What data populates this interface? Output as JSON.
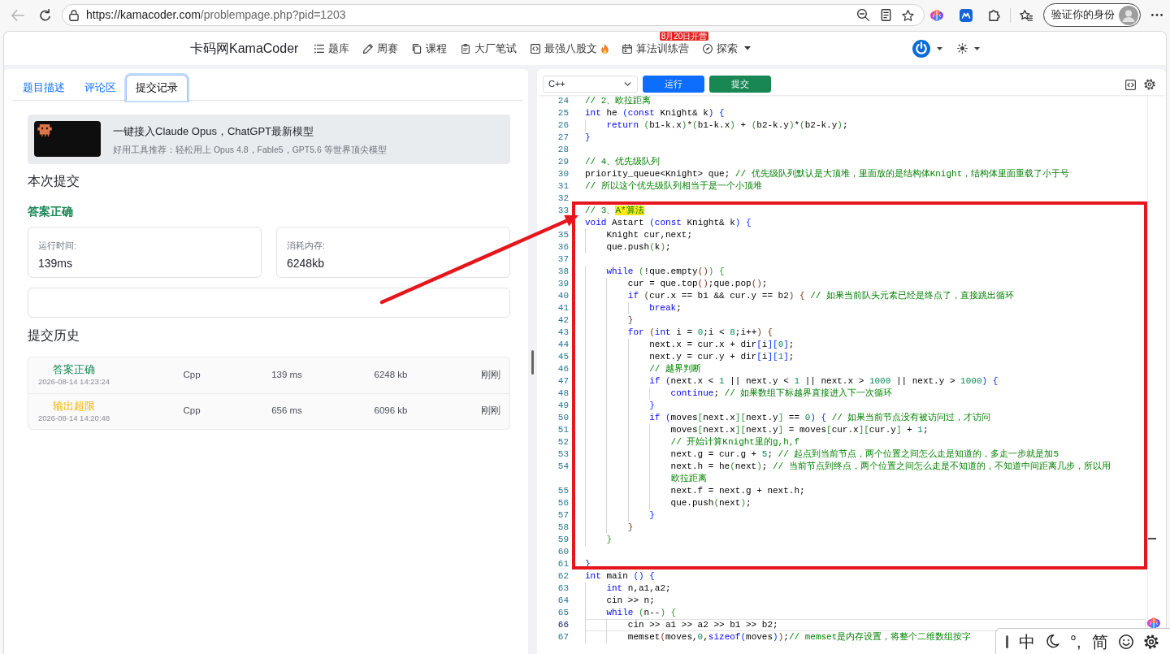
{
  "browser": {
    "back_disabled": true,
    "url_host": "https://kamacoder.com",
    "url_path": "/problempage.php?pid=1203",
    "profile_button": "验证你的身份"
  },
  "site_nav": {
    "brand": "卡码网KamaCoder",
    "items": [
      {
        "label": "题库",
        "hot": false,
        "dropdown": false
      },
      {
        "label": "周赛",
        "hot": false,
        "dropdown": false
      },
      {
        "label": "课程",
        "hot": false,
        "dropdown": false
      },
      {
        "label": "大厂笔试",
        "hot": false,
        "dropdown": false
      },
      {
        "label": "最强八股文",
        "hot": true,
        "dropdown": false
      },
      {
        "label": "算法训练营",
        "hot": false,
        "dropdown": false,
        "badge": "8月20日开营"
      },
      {
        "label": "探索",
        "hot": false,
        "dropdown": true
      }
    ]
  },
  "left_panel": {
    "tabs": [
      {
        "label": "题目描述",
        "selected": false
      },
      {
        "label": "评论区",
        "selected": false
      },
      {
        "label": "提交记录",
        "selected": true
      }
    ],
    "banner": {
      "title": "一键接入Claude Opus，ChatGPT最新模型",
      "subtitle": "好用工具推荐：轻松用上 Opus 4.8，Fable5，GPT5.6 等世界顶尖模型"
    },
    "current_title": "本次提交",
    "verdict": {
      "text": "答案正确",
      "kind": "accepted"
    },
    "stats": [
      {
        "label": "运行时间:",
        "value": "139ms"
      },
      {
        "label": "消耗内存:",
        "value": "6248kb"
      }
    ],
    "history_title": "提交历史",
    "history": [
      {
        "verdict": "答案正确",
        "kind": "accepted",
        "submitted_at": "2026-08-14 14:23:24",
        "language": "Cpp",
        "runtime": "139 ms",
        "memory": "6248 kb",
        "age": "刚刚"
      },
      {
        "verdict": "输出超限",
        "kind": "exceeded",
        "submitted_at": "2026-08-14 14:20:48",
        "language": "Cpp",
        "runtime": "656 ms",
        "memory": "6096 kb",
        "age": "刚刚"
      }
    ]
  },
  "editor": {
    "language": "C++",
    "buttons": [
      {
        "label": "运行",
        "kind": "run"
      },
      {
        "label": "提交",
        "kind": "submit"
      }
    ],
    "lines": [
      {
        "number": "24",
        "current": false,
        "tokens": [
          {
            "kind": "cm",
            "text": "// 2、欧拉距离"
          }
        ]
      },
      {
        "number": "25",
        "current": false,
        "tokens": [
          {
            "kind": "kw",
            "text": "int"
          },
          {
            "kind": "txt",
            "text": " he "
          },
          {
            "kind": "br1",
            "text": "("
          },
          {
            "kind": "kw",
            "text": "const"
          },
          {
            "kind": "txt",
            "text": " Knight& k"
          },
          {
            "kind": "br1",
            "text": ") {"
          }
        ]
      },
      {
        "number": "26",
        "current": false,
        "tokens": [
          {
            "kind": "kw",
            "text": "    return"
          },
          {
            "kind": "br2",
            "text": " ("
          },
          {
            "kind": "txt",
            "text": "b1-k.x"
          },
          {
            "kind": "br2",
            "text": ")"
          },
          {
            "kind": "txt",
            "text": "*"
          },
          {
            "kind": "br2",
            "text": "("
          },
          {
            "kind": "txt",
            "text": "b1-k.x"
          },
          {
            "kind": "br2",
            "text": ")"
          },
          {
            "kind": "txt",
            "text": " + "
          },
          {
            "kind": "br2",
            "text": "("
          },
          {
            "kind": "txt",
            "text": "b2-k.y"
          },
          {
            "kind": "br2",
            "text": ")"
          },
          {
            "kind": "txt",
            "text": "*"
          },
          {
            "kind": "br2",
            "text": "("
          },
          {
            "kind": "txt",
            "text": "b2-k.y"
          },
          {
            "kind": "br2",
            "text": ")"
          },
          {
            "kind": "txt",
            "text": ";"
          }
        ]
      },
      {
        "number": "27",
        "current": false,
        "tokens": [
          {
            "kind": "br1",
            "text": "}"
          }
        ]
      },
      {
        "number": "28",
        "current": false
      },
      {
        "number": "29",
        "current": false,
        "tokens": [
          {
            "kind": "cm",
            "text": "// 4、优先级队列"
          }
        ]
      },
      {
        "number": "30",
        "current": false,
        "tokens": [
          {
            "kind": "txt",
            "text": "priority_queue<Knight> que; "
          },
          {
            "kind": "cm",
            "text": "// 优先级队列默认是大顶堆，里面放的是结构体Knight，结构体里面重载了小于号"
          }
        ]
      },
      {
        "number": "31",
        "current": false,
        "tokens": [
          {
            "kind": "cm",
            "text": "// 所以这个优先级队列相当于是一个小顶堆"
          }
        ]
      },
      {
        "number": "32",
        "current": false
      },
      {
        "number": "33",
        "current": false,
        "tokens": [
          {
            "kind": "cm",
            "text": "// 3、"
          },
          {
            "kind": "hl",
            "text": "A*算法"
          }
        ]
      },
      {
        "current": false,
        "tokens": [
          {
            "kind": "kw",
            "text": "void"
          },
          {
            "kind": "txt",
            "text": " Astart "
          },
          {
            "kind": "br1",
            "text": "("
          },
          {
            "kind": "kw",
            "text": "const"
          },
          {
            "kind": "txt",
            "text": " Knight& k"
          },
          {
            "kind": "br1",
            "text": ") {"
          }
        ]
      },
      {
        "number": "35",
        "current": false,
        "tokens": [
          {
            "kind": "txt",
            "text": "    Knight cur,next;"
          }
        ]
      },
      {
        "number": "36",
        "current": false,
        "tokens": [
          {
            "kind": "txt",
            "text": "    que.push"
          },
          {
            "kind": "br2",
            "text": "("
          },
          {
            "kind": "txt",
            "text": "k"
          },
          {
            "kind": "br2",
            "text": ")"
          },
          {
            "kind": "txt",
            "text": ";"
          }
        ]
      },
      {
        "number": "37",
        "current": false
      },
      {
        "number": "38",
        "current": false,
        "tokens": [
          {
            "kind": "kw",
            "text": "    while"
          },
          {
            "kind": "br2",
            "text": " ("
          },
          {
            "kind": "txt",
            "text": "!que.empty"
          },
          {
            "kind": "br3",
            "text": "()"
          },
          {
            "kind": "br2",
            "text": ") {"
          }
        ]
      },
      {
        "number": "39",
        "current": false,
        "tokens": [
          {
            "kind": "txt",
            "text": "        cur = que.top"
          },
          {
            "kind": "br3",
            "text": "()"
          },
          {
            "kind": "txt",
            "text": ";que.pop"
          },
          {
            "kind": "br3",
            "text": "()"
          },
          {
            "kind": "txt",
            "text": ";"
          }
        ]
      },
      {
        "number": "40",
        "current": false,
        "tokens": [
          {
            "kind": "kw",
            "text": "        if"
          },
          {
            "kind": "br3",
            "text": " ("
          },
          {
            "kind": "txt",
            "text": "cur.x == b1 && cur.y == b2"
          },
          {
            "kind": "br3",
            "text": ") {"
          },
          {
            "kind": "cm",
            "text": " // 如果当前队头元素已经是终点了，直接跳出循环"
          }
        ]
      },
      {
        "number": "41",
        "current": false,
        "tokens": [
          {
            "kind": "kw",
            "text": "            break"
          },
          {
            "kind": "txt",
            "text": ";"
          }
        ]
      },
      {
        "number": "42",
        "current": false,
        "tokens": [
          {
            "kind": "br3",
            "text": "        }"
          }
        ]
      },
      {
        "number": "43",
        "current": false,
        "tokens": [
          {
            "kind": "kw",
            "text": "        for"
          },
          {
            "kind": "br3",
            "text": " ("
          },
          {
            "kind": "kw",
            "text": "int"
          },
          {
            "kind": "txt",
            "text": " i = "
          },
          {
            "kind": "num",
            "text": "0"
          },
          {
            "kind": "txt",
            "text": ";i < "
          },
          {
            "kind": "num",
            "text": "8"
          },
          {
            "kind": "txt",
            "text": ";i++"
          },
          {
            "kind": "br3",
            "text": ") {"
          }
        ]
      },
      {
        "number": "44",
        "current": false,
        "tokens": [
          {
            "kind": "txt",
            "text": "            next.x = cur.x + dir"
          },
          {
            "kind": "br1",
            "text": "["
          },
          {
            "kind": "txt",
            "text": "i"
          },
          {
            "kind": "br1",
            "text": "]["
          },
          {
            "kind": "num",
            "text": "0"
          },
          {
            "kind": "br1",
            "text": "]"
          },
          {
            "kind": "txt",
            "text": ";"
          }
        ]
      },
      {
        "number": "45",
        "current": false,
        "tokens": [
          {
            "kind": "txt",
            "text": "            next.y = cur.y + dir"
          },
          {
            "kind": "br1",
            "text": "["
          },
          {
            "kind": "txt",
            "text": "i"
          },
          {
            "kind": "br1",
            "text": "]["
          },
          {
            "kind": "num",
            "text": "1"
          },
          {
            "kind": "br1",
            "text": "]"
          },
          {
            "kind": "txt",
            "text": ";"
          }
        ]
      },
      {
        "number": "46",
        "current": false,
        "tokens": [
          {
            "kind": "cm",
            "text": "            // 越界判断"
          }
        ]
      },
      {
        "number": "47",
        "current": false,
        "tokens": [
          {
            "kind": "kw",
            "text": "            if"
          },
          {
            "kind": "br1",
            "text": " ("
          },
          {
            "kind": "txt",
            "text": "next.x < "
          },
          {
            "kind": "num",
            "text": "1"
          },
          {
            "kind": "txt",
            "text": " || next.y < "
          },
          {
            "kind": "num",
            "text": "1"
          },
          {
            "kind": "txt",
            "text": " || next.x > "
          },
          {
            "kind": "num",
            "text": "1000"
          },
          {
            "kind": "txt",
            "text": " || next.y > "
          },
          {
            "kind": "num",
            "text": "1000"
          },
          {
            "kind": "br1",
            "text": ") {"
          }
        ]
      },
      {
        "number": "48",
        "current": false,
        "tokens": [
          {
            "kind": "kw",
            "text": "                continue"
          },
          {
            "kind": "txt",
            "text": "; "
          },
          {
            "kind": "cm",
            "text": "// 如果数组下标越界直接进入下一次循环"
          }
        ]
      },
      {
        "number": "49",
        "current": false,
        "tokens": [
          {
            "kind": "br1",
            "text": "            }"
          }
        ]
      },
      {
        "number": "50",
        "current": false,
        "tokens": [
          {
            "kind": "kw",
            "text": "            if"
          },
          {
            "kind": "br1",
            "text": " ("
          },
          {
            "kind": "txt",
            "text": "moves"
          },
          {
            "kind": "br2",
            "text": "["
          },
          {
            "kind": "txt",
            "text": "next.x"
          },
          {
            "kind": "br2",
            "text": "]["
          },
          {
            "kind": "txt",
            "text": "next.y"
          },
          {
            "kind": "br2",
            "text": "]"
          },
          {
            "kind": "txt",
            "text": " == "
          },
          {
            "kind": "num",
            "text": "0"
          },
          {
            "kind": "br1",
            "text": ") {"
          },
          {
            "kind": "cm",
            "text": " // 如果当前节点没有被访问过，才访问"
          }
        ]
      },
      {
        "number": "51",
        "current": false,
        "tokens": [
          {
            "kind": "txt",
            "text": "                moves"
          },
          {
            "kind": "br2",
            "text": "["
          },
          {
            "kind": "txt",
            "text": "next.x"
          },
          {
            "kind": "br2",
            "text": "]["
          },
          {
            "kind": "txt",
            "text": "next.y"
          },
          {
            "kind": "br2",
            "text": "]"
          },
          {
            "kind": "txt",
            "text": " = moves"
          },
          {
            "kind": "br2",
            "text": "["
          },
          {
            "kind": "txt",
            "text": "cur.x"
          },
          {
            "kind": "br2",
            "text": "]["
          },
          {
            "kind": "txt",
            "text": "cur.y"
          },
          {
            "kind": "br2",
            "text": "]"
          },
          {
            "kind": "txt",
            "text": " + "
          },
          {
            "kind": "num",
            "text": "1"
          },
          {
            "kind": "txt",
            "text": ";"
          }
        ]
      },
      {
        "number": "52",
        "current": false,
        "tokens": [
          {
            "kind": "cm",
            "text": "                // 开始计算Knight里的g,h,f"
          }
        ]
      },
      {
        "number": "53",
        "current": false,
        "tokens": [
          {
            "kind": "txt",
            "text": "                next.g = cur.g + "
          },
          {
            "kind": "num",
            "text": "5"
          },
          {
            "kind": "txt",
            "text": "; "
          },
          {
            "kind": "cm",
            "text": "// 起点到当前节点，两个位置之间怎么走是知道的，多走一步就是加5"
          }
        ]
      },
      {
        "number": "54",
        "current": false,
        "tokens": [
          {
            "kind": "txt",
            "text": "                next.h = he"
          },
          {
            "kind": "br2",
            "text": "("
          },
          {
            "kind": "txt",
            "text": "next"
          },
          {
            "kind": "br2",
            "text": ")"
          },
          {
            "kind": "txt",
            "text": "; "
          },
          {
            "kind": "cm",
            "text": "// 当前节点到终点，两个位置之间怎么走是不知道的，不知道中间距离几步，所以用"
          }
        ],
        "wrap": [
          {
            "kind": "cm",
            "text": "                欧拉距离"
          }
        ]
      },
      {
        "number": "55",
        "current": false,
        "tokens": [
          {
            "kind": "txt",
            "text": "                next.f = next.g + next.h;"
          }
        ]
      },
      {
        "number": "56",
        "current": false,
        "tokens": [
          {
            "kind": "txt",
            "text": "                que.push"
          },
          {
            "kind": "br2",
            "text": "("
          },
          {
            "kind": "txt",
            "text": "next"
          },
          {
            "kind": "br2",
            "text": ")"
          },
          {
            "kind": "txt",
            "text": ";"
          }
        ]
      },
      {
        "number": "57",
        "current": false,
        "tokens": [
          {
            "kind": "br1",
            "text": "            }"
          }
        ]
      },
      {
        "number": "58",
        "current": false,
        "tokens": [
          {
            "kind": "br3",
            "text": "        }"
          }
        ]
      },
      {
        "number": "59",
        "current": false,
        "tokens": [
          {
            "kind": "br2",
            "text": "    }"
          }
        ]
      },
      {
        "number": "60",
        "current": false
      },
      {
        "number": "61",
        "current": false,
        "tokens": [
          {
            "kind": "br1",
            "text": "}"
          }
        ]
      },
      {
        "number": "62",
        "current": false,
        "tokens": [
          {
            "kind": "kw",
            "text": "int"
          },
          {
            "kind": "txt",
            "text": " main "
          },
          {
            "kind": "br1",
            "text": "() {"
          }
        ]
      },
      {
        "number": "63",
        "current": false,
        "tokens": [
          {
            "kind": "kw",
            "text": "    int"
          },
          {
            "kind": "txt",
            "text": " n,a1,a2;"
          }
        ]
      },
      {
        "number": "64",
        "current": false,
        "tokens": [
          {
            "kind": "txt",
            "text": "    cin >> n;"
          }
        ]
      },
      {
        "number": "65",
        "current": false,
        "tokens": [
          {
            "kind": "kw",
            "text": "    while"
          },
          {
            "kind": "br2",
            "text": " ("
          },
          {
            "kind": "txt",
            "text": "n--"
          },
          {
            "kind": "br2",
            "text": ") {"
          }
        ]
      },
      {
        "number": "66",
        "current": true,
        "tokens": [
          {
            "kind": "txt",
            "text": "        cin >> a1 >> a2 >> b1 >> b2;"
          }
        ]
      },
      {
        "number": "67",
        "current": false,
        "tokens": [
          {
            "kind": "txt",
            "text": "        memset"
          },
          {
            "kind": "br3",
            "text": "("
          },
          {
            "kind": "txt",
            "text": "moves,"
          },
          {
            "kind": "num",
            "text": "0"
          },
          {
            "kind": "txt",
            "text": ","
          },
          {
            "kind": "kw",
            "text": "sizeof"
          },
          {
            "kind": "br1",
            "text": "("
          },
          {
            "kind": "txt",
            "text": "moves"
          },
          {
            "kind": "br1",
            "text": ")"
          },
          {
            "kind": "br3",
            "text": ")"
          },
          {
            "kind": "txt",
            "text": ";"
          },
          {
            "kind": "cm",
            "text": "// memset是内存设置，将整个二维数组按字"
          }
        ]
      }
    ]
  },
  "ime_bar": {
    "mode": "中",
    "punctuation": "°,",
    "script": "简"
  }
}
